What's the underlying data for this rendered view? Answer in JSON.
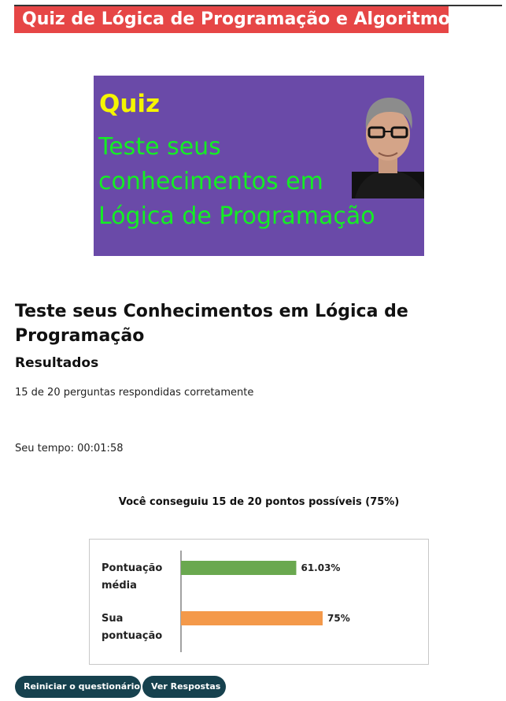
{
  "page": {
    "heading": "Quiz de Lógica de Programação e Algoritmos"
  },
  "banner": {
    "quiz": "Quiz",
    "line1": "Teste seus",
    "line2": "conhecimentos em",
    "line3": "Lógica de Programação",
    "quiz_color": "#f5f500",
    "text_color": "#14ee24",
    "background": "#6a4aa8"
  },
  "quiz": {
    "title": "Teste seus Conhecimentos em Lógica de Programação",
    "results_title": "Resultados",
    "correct_text": "15 de 20 perguntas respondidas corretamente",
    "time_text": "Seu tempo: 00:01:58",
    "points_text": "Você conseguiu 15 de 20 pontos possíveis (75%)"
  },
  "chart_data": {
    "type": "bar",
    "orientation": "horizontal",
    "categories": [
      "Pontuação média",
      "Sua pontuação"
    ],
    "category_lines": [
      [
        "Pontuação",
        "média"
      ],
      [
        "Sua",
        "pontuação"
      ]
    ],
    "values": [
      61.03,
      75
    ],
    "value_labels": [
      "61.03%",
      "75%"
    ],
    "colors": [
      "#6aa84f",
      "#f4994a"
    ],
    "xlim": [
      0,
      100
    ],
    "title": "",
    "xlabel": "",
    "ylabel": ""
  },
  "buttons": {
    "restart": "Reiniciar o questionário",
    "view_answers": "Ver Respostas"
  }
}
